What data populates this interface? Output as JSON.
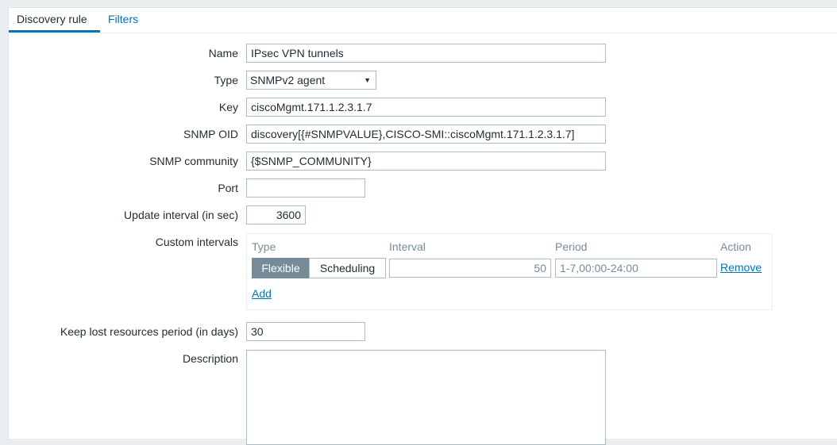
{
  "tabs": [
    {
      "label": "Discovery rule",
      "active": true
    },
    {
      "label": "Filters",
      "active": false
    }
  ],
  "form": {
    "name": {
      "label": "Name",
      "value": "IPsec VPN tunnels"
    },
    "type": {
      "label": "Type",
      "value": "SNMPv2 agent"
    },
    "key": {
      "label": "Key",
      "value": "ciscoMgmt.171.1.2.3.1.7"
    },
    "snmp_oid": {
      "label": "SNMP OID",
      "value": "discovery[{#SNMPVALUE},CISCO-SMI::ciscoMgmt.171.1.2.3.1.7]"
    },
    "snmp_community": {
      "label": "SNMP community",
      "value": "{$SNMP_COMMUNITY}"
    },
    "port": {
      "label": "Port",
      "value": ""
    },
    "update_interval": {
      "label": "Update interval (in sec)",
      "value": "3600"
    },
    "custom_intervals": {
      "label": "Custom intervals",
      "headers": {
        "type": "Type",
        "interval": "Interval",
        "period": "Period",
        "action": "Action"
      },
      "row": {
        "type_options": [
          "Flexible",
          "Scheduling"
        ],
        "selected_type": "Flexible",
        "interval": "50",
        "period": "1-7,00:00-24:00",
        "remove_label": "Remove"
      },
      "add_label": "Add"
    },
    "keep_lost": {
      "label": "Keep lost resources period (in days)",
      "value": "30"
    },
    "description": {
      "label": "Description",
      "value": ""
    }
  },
  "colors": {
    "accent": "#0275b8",
    "selected_segment": "#768d99"
  }
}
